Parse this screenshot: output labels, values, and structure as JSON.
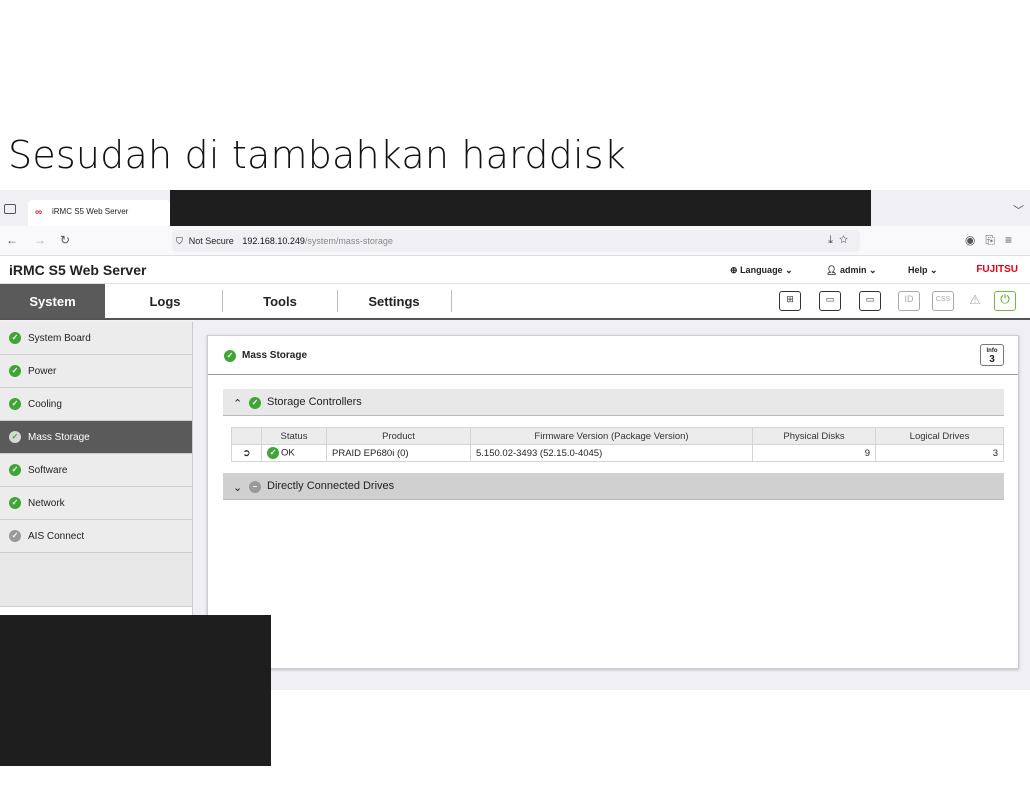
{
  "slide": {
    "title": "Sesudah di tambahkan harddisk"
  },
  "browser": {
    "tab_title": "iRMC S5 Web Server",
    "security_label": "Not Secure",
    "url_host": "192.168.10.249",
    "url_path": "/system/mass-storage"
  },
  "app": {
    "brand": "iRMC S5 Web Server",
    "language_label": "Language",
    "user_label": "admin",
    "help_label": "Help",
    "vendor": "FUJITSU"
  },
  "mainnav": {
    "items": [
      {
        "label": "System"
      },
      {
        "label": "Logs"
      },
      {
        "label": "Tools"
      },
      {
        "label": "Settings"
      }
    ]
  },
  "toolbar_icons": [
    "grid-icon",
    "chat-icon",
    "window-icon",
    "id-icon",
    "css-icon",
    "warning-icon",
    "power-icon"
  ],
  "sidebar": {
    "items": [
      {
        "label": "System Board"
      },
      {
        "label": "Power"
      },
      {
        "label": "Cooling"
      },
      {
        "label": "Mass Storage"
      },
      {
        "label": "Software"
      },
      {
        "label": "Network"
      },
      {
        "label": "AIS Connect"
      }
    ]
  },
  "content": {
    "title": "Mass Storage",
    "info": {
      "label": "Info",
      "count": "3"
    },
    "storage_controllers": {
      "label": "Storage Controllers",
      "columns": [
        "Status",
        "Product",
        "Firmware Version (Package Version)",
        "Physical Disks",
        "Logical Drives"
      ],
      "rows": [
        {
          "status": "OK",
          "product": "PRAID EP680i (0)",
          "firmware": "5.150.02-3493 (52.15.0-4045)",
          "physical_disks": "9",
          "logical_drives": "3"
        }
      ]
    },
    "direct_drives": {
      "label": "Directly Connected Drives"
    }
  },
  "colors": {
    "ok_green": "#3fa535",
    "vendor_red": "#e60012",
    "active_nav": "#5a5a5a"
  }
}
